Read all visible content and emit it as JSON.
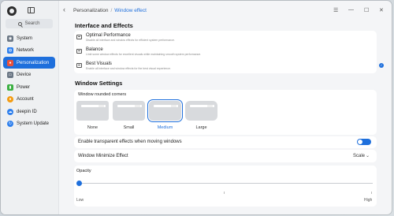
{
  "search": {
    "placeholder": "Search"
  },
  "sidebar": {
    "items": [
      {
        "label": "System",
        "icon": "system-icon",
        "color": "#6b7785"
      },
      {
        "label": "Network",
        "icon": "network-icon",
        "color": "#2f80ed"
      },
      {
        "label": "Personalization",
        "icon": "personalization-icon",
        "color": "#e8513b",
        "active": true
      },
      {
        "label": "Device",
        "icon": "device-icon",
        "color": "#6b7785"
      },
      {
        "label": "Power",
        "icon": "power-icon",
        "color": "#3cb043"
      },
      {
        "label": "Account",
        "icon": "account-icon",
        "color": "#f39c12"
      },
      {
        "label": "deepin ID",
        "icon": "deepin-id-icon",
        "color": "#2f80ed"
      },
      {
        "label": "System Update",
        "icon": "update-icon",
        "color": "#2f80ed"
      }
    ]
  },
  "breadcrumb": {
    "parent": "Personalization",
    "separator": "/",
    "current": "Window effect"
  },
  "window_controls": {
    "menu": "☰",
    "minimize": "—",
    "maximize": "☐",
    "close": "✕"
  },
  "interface": {
    "title": "Interface and Effects",
    "options": [
      {
        "title": "Optimal Performance",
        "desc": "Disable all interface and window effects for efficient system performance.",
        "checked": false
      },
      {
        "title": "Balance",
        "desc": "Limit some window effects for excellent visuals while maintaining smooth system performance.",
        "checked": false
      },
      {
        "title": "Best Visuals",
        "desc": "Enable all interface and window effects for the best visual experience.",
        "checked": true
      }
    ]
  },
  "window_settings": {
    "title": "Window Settings",
    "rounded_label": "Window rounded corners",
    "corners": [
      "None",
      "Small",
      "Medium",
      "Large"
    ],
    "corner_selected": "Medium",
    "transparent_label": "Enable transparent effects when moving windows",
    "transparent_on": true,
    "minimize_label": "Window Minimize Effect",
    "minimize_value": "Scale",
    "opacity_label": "Opacity",
    "opacity_low": "Low",
    "opacity_high": "High",
    "opacity_value": 0.0
  },
  "colors": {
    "accent": "#1e6fdc"
  }
}
